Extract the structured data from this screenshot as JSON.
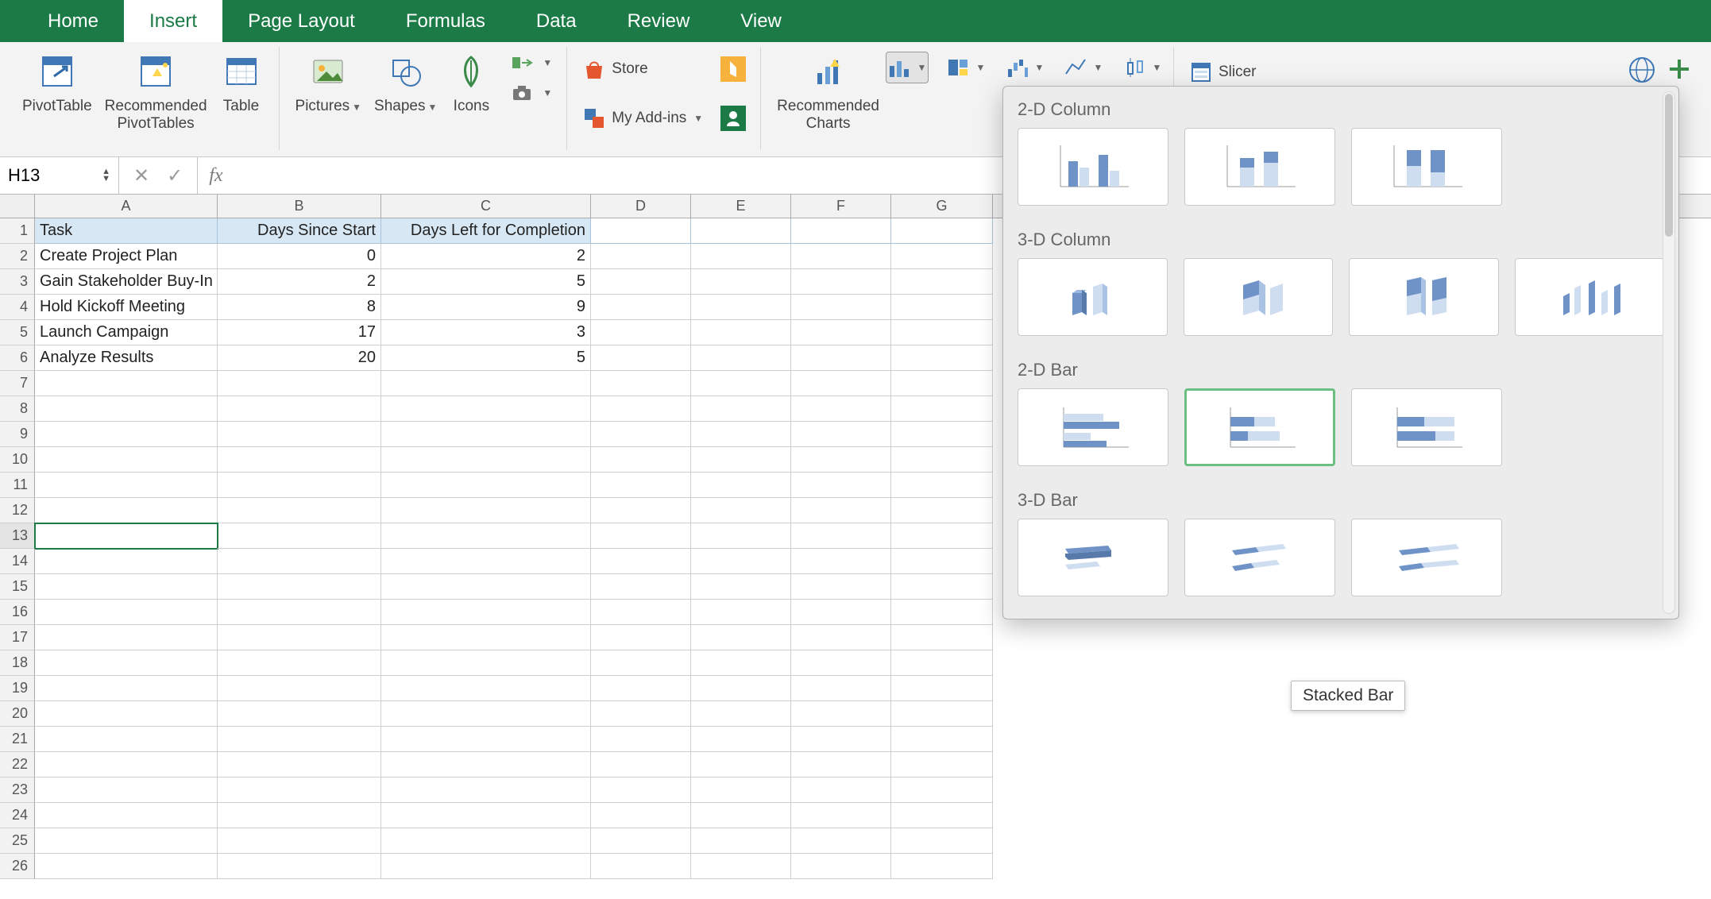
{
  "tabs": [
    "Home",
    "Insert",
    "Page Layout",
    "Formulas",
    "Data",
    "Review",
    "View"
  ],
  "active_tab": "Insert",
  "ribbon": {
    "pivottable": "PivotTable",
    "rec_pivot": "Recommended\nPivotTables",
    "table": "Table",
    "pictures": "Pictures",
    "shapes": "Shapes",
    "icons": "Icons",
    "store": "Store",
    "myaddins": "My Add-ins",
    "rec_charts": "Recommended\nCharts",
    "slicer": "Slicer"
  },
  "namebox": "H13",
  "formula": "",
  "columns": [
    "A",
    "B",
    "C",
    "D",
    "E",
    "F",
    "G"
  ],
  "headers": {
    "A": "Task",
    "B": "Days Since Start",
    "C": "Days Left for Completion"
  },
  "rows": [
    {
      "A": "Create Project Plan",
      "B": 0,
      "C": 2
    },
    {
      "A": "Gain Stakeholder Buy-In",
      "B": 2,
      "C": 5
    },
    {
      "A": "Hold Kickoff Meeting",
      "B": 8,
      "C": 9
    },
    {
      "A": "Launch Campaign",
      "B": 17,
      "C": 3
    },
    {
      "A": "Analyze Results",
      "B": 20,
      "C": 5
    }
  ],
  "selected_cell": "H13",
  "panel": {
    "sections": [
      "2-D Column",
      "3-D Column",
      "2-D Bar",
      "3-D Bar"
    ],
    "tooltip": "Stacked Bar"
  }
}
